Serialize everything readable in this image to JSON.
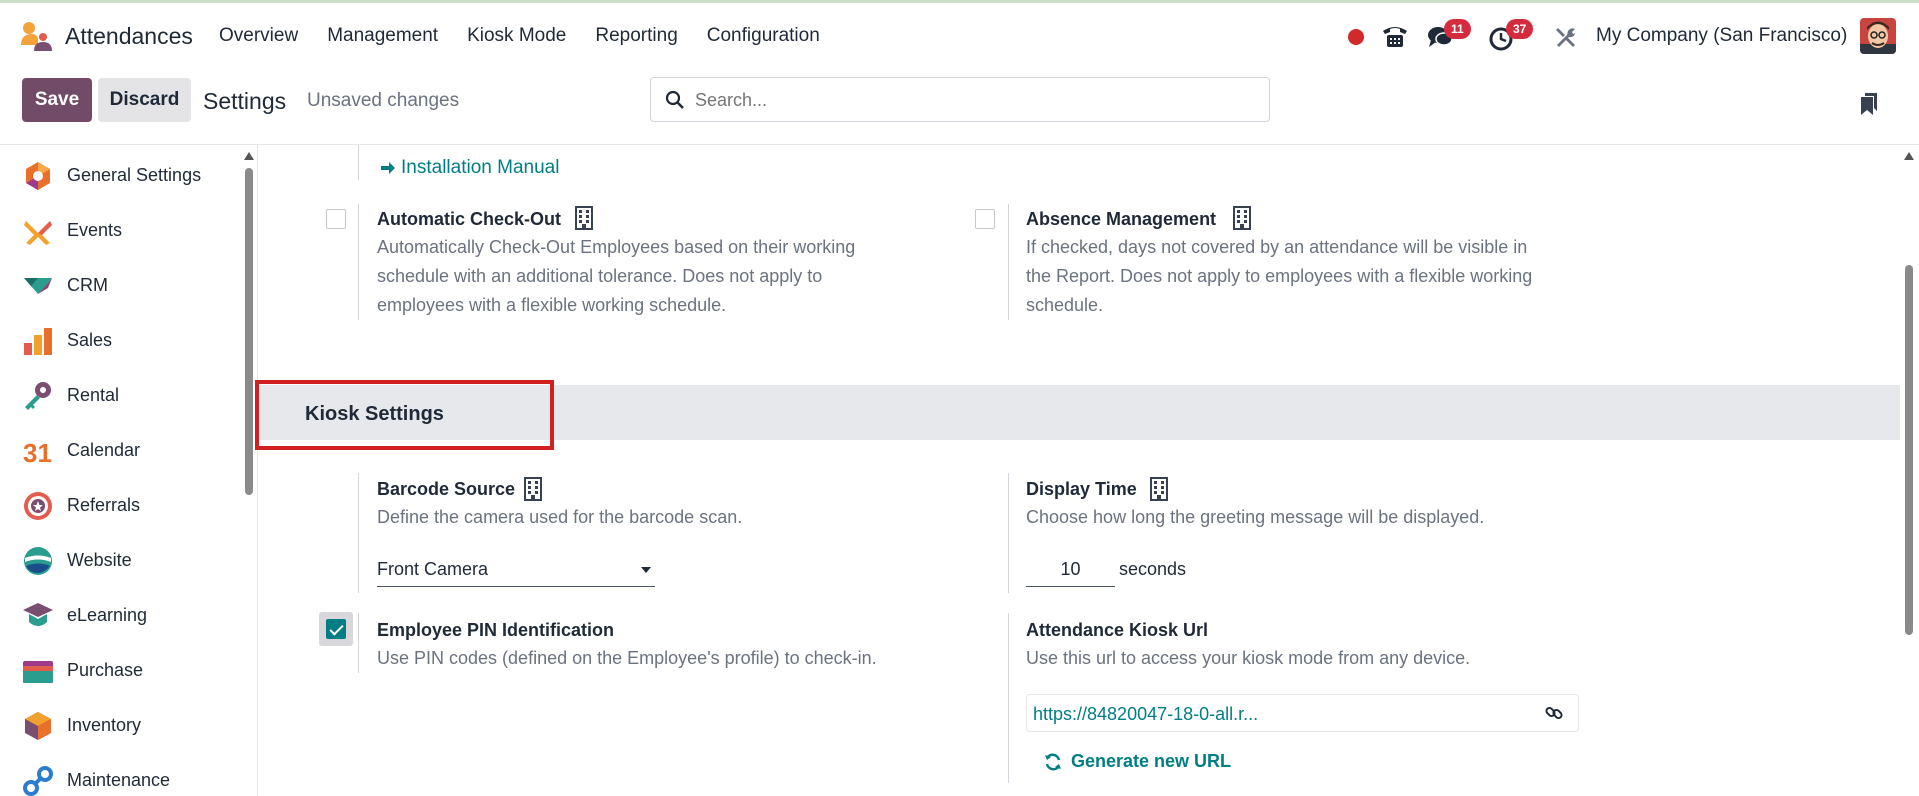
{
  "app": {
    "name": "Attendances",
    "menu": [
      "Overview",
      "Management",
      "Kiosk Mode",
      "Reporting",
      "Configuration"
    ],
    "messages_badge": "11",
    "activities_badge": "37",
    "company": "My Company (San Francisco)"
  },
  "control_panel": {
    "save_label": "Save",
    "discard_label": "Discard",
    "title": "Settings",
    "status": "Unsaved changes",
    "search_placeholder": "Search..."
  },
  "sidebar": {
    "items": [
      {
        "label": "General Settings",
        "icon": "general-settings-icon"
      },
      {
        "label": "Events",
        "icon": "events-icon"
      },
      {
        "label": "CRM",
        "icon": "crm-icon"
      },
      {
        "label": "Sales",
        "icon": "sales-icon"
      },
      {
        "label": "Rental",
        "icon": "rental-icon"
      },
      {
        "label": "Calendar",
        "icon": "calendar-icon",
        "icon_text": "31"
      },
      {
        "label": "Referrals",
        "icon": "referrals-icon"
      },
      {
        "label": "Website",
        "icon": "website-icon"
      },
      {
        "label": "eLearning",
        "icon": "elearning-icon"
      },
      {
        "label": "Purchase",
        "icon": "purchase-icon"
      },
      {
        "label": "Inventory",
        "icon": "inventory-icon"
      },
      {
        "label": "Maintenance",
        "icon": "maintenance-icon"
      }
    ]
  },
  "main": {
    "installation_manual": "Installation Manual",
    "auto_checkout": {
      "title": "Automatic Check-Out",
      "desc_lines": [
        "Automatically Check-Out Employees based on their working",
        "schedule with an additional tolerance. Does not apply to",
        "employees with a flexible working schedule."
      ],
      "checked": false
    },
    "absence": {
      "title": "Absence Management",
      "desc_lines": [
        "If checked, days not covered by an attendance will be visible in",
        "the Report. Does not apply to employees with a flexible working",
        "schedule."
      ],
      "checked": false
    },
    "kiosk_section": "Kiosk Settings",
    "barcode": {
      "title": "Barcode Source",
      "desc": "Define the camera used for the barcode scan.",
      "value": "Front Camera"
    },
    "display_time": {
      "title": "Display Time",
      "desc": "Choose how long the greeting message will be displayed.",
      "value": "10",
      "unit": "seconds"
    },
    "pin": {
      "title": "Employee PIN Identification",
      "desc": "Use PIN codes (defined on the Employee's profile) to check-in.",
      "checked": true
    },
    "kiosk_url": {
      "title": "Attendance Kiosk Url",
      "desc": "Use this url to access your kiosk mode from any device.",
      "value": "https://84820047-18-0-all.r...",
      "generate_label": "Generate new URL"
    }
  },
  "colors": {
    "primary": "#714b67",
    "accent": "#017e84",
    "highlight": "#d12020",
    "badge": "#d42b3e"
  }
}
